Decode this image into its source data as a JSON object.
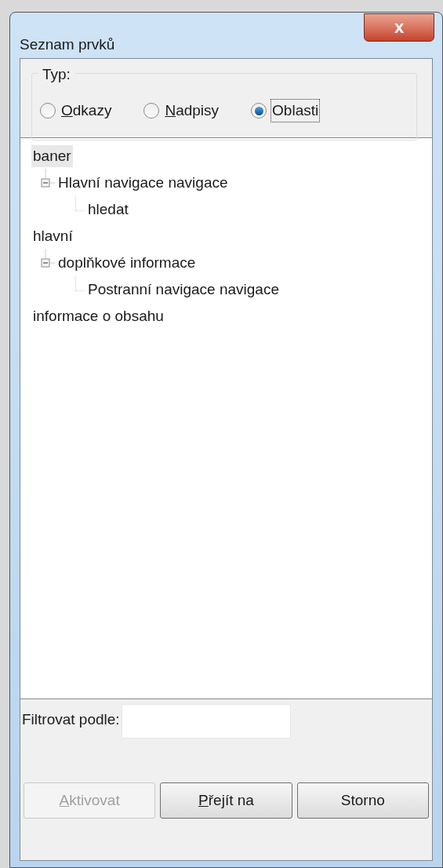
{
  "window": {
    "title": "Seznam prvků",
    "close": "x"
  },
  "type_group": {
    "label": "Typ:",
    "options": [
      {
        "label": "Odkazy",
        "mnemonic": true,
        "selected": false,
        "focused": false
      },
      {
        "label": "Nadpisy",
        "mnemonic": true,
        "selected": false,
        "focused": false
      },
      {
        "label": "Oblasti",
        "mnemonic": false,
        "selected": true,
        "focused": true
      }
    ]
  },
  "tree": [
    {
      "label": "baner",
      "selected": true,
      "children": [
        {
          "label": "Hlavní navigace navigace",
          "selected": false,
          "expanded": true,
          "children": [
            {
              "label": "hledat",
              "selected": false
            }
          ]
        }
      ]
    },
    {
      "label": "hlavní",
      "selected": false,
      "children": [
        {
          "label": "doplňkové informace",
          "selected": false,
          "expanded": true,
          "children": [
            {
              "label": "Postranní navigace navigace",
              "selected": false
            }
          ]
        }
      ]
    },
    {
      "label": "informace o obsahu",
      "selected": false
    }
  ],
  "filter": {
    "label": "Filtrovat podle:"
  },
  "buttons": [
    {
      "label": "Aktivovat",
      "mnemonic": true,
      "disabled": true
    },
    {
      "label": "Přejít na",
      "mnemonic": true,
      "disabled": false
    },
    {
      "label": "Storno",
      "mnemonic": false,
      "disabled": false
    }
  ]
}
